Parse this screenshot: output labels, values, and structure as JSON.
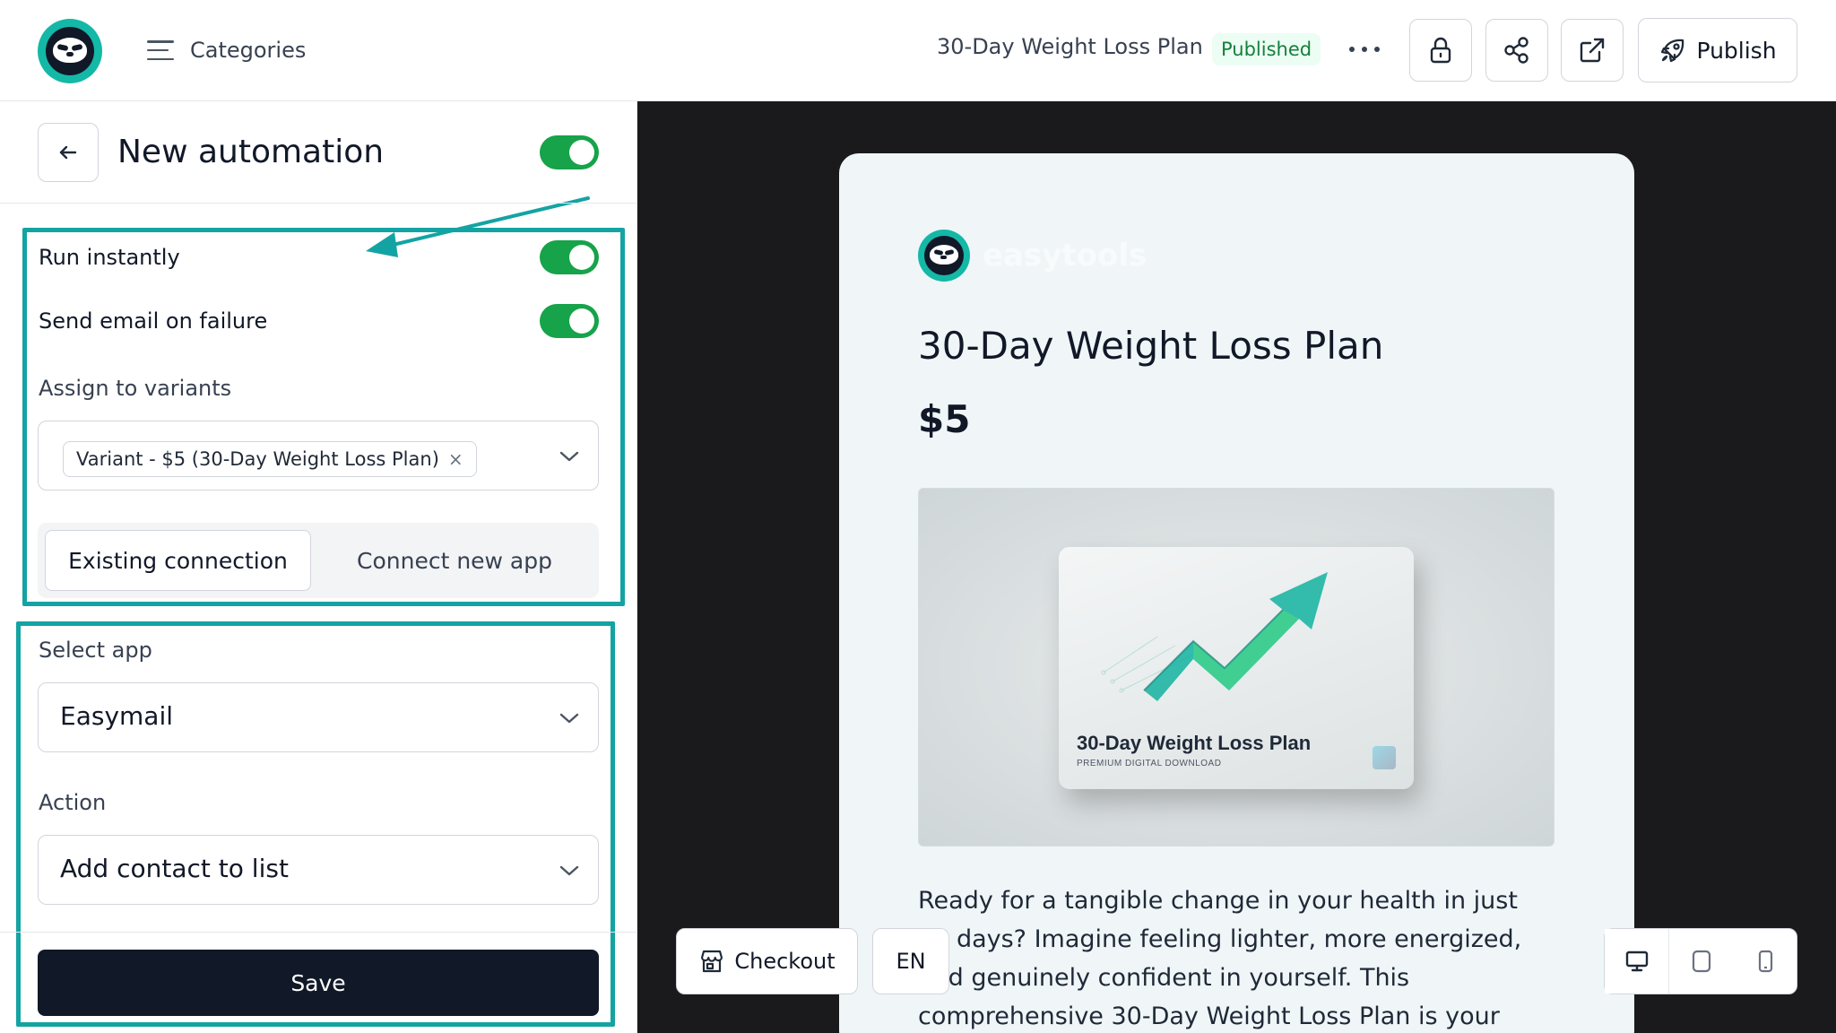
{
  "header": {
    "categories_label": "Categories",
    "doc_title": "30-Day Weight Loss Plan",
    "status_badge": "Published",
    "publish_label": "Publish"
  },
  "panel": {
    "title": "New automation",
    "enabled": true,
    "run_instantly_label": "Run instantly",
    "run_instantly": true,
    "email_failure_label": "Send email on failure",
    "email_failure": true,
    "variants_label": "Assign to variants",
    "variant_chip": "Variant - $5 (30-Day Weight Loss Plan)",
    "variant_chip_remove": "×",
    "tabs": [
      {
        "label": "Existing connection",
        "active": true
      },
      {
        "label": "Connect new app",
        "active": false
      }
    ],
    "select_app_label": "Select app",
    "select_app_value": "Easymail",
    "action_label": "Action",
    "action_value": "Add contact to list",
    "save_label": "Save"
  },
  "preview": {
    "brand": "easytools",
    "product_title": "30-Day Weight Loss Plan",
    "price": "$5",
    "image": {
      "title": "30-Day Weight Loss Plan",
      "subtitle": "PREMIUM DIGITAL DOWNLOAD"
    },
    "description": "Ready for a tangible change in your health in just 30 days? Imagine feeling lighter, more energized, and genuinely confident in yourself. This comprehensive 30-Day Weight Loss Plan is your guide to achieving",
    "checkout_label": "Checkout",
    "language": "EN"
  },
  "colors": {
    "accent_teal": "#14a3a3",
    "toggle_green": "#16a34a",
    "save_button": "#111827",
    "preview_bg": "#1a1a1d"
  }
}
